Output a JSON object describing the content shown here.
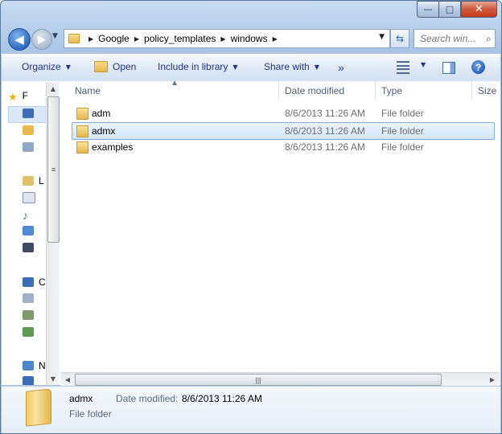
{
  "window": {
    "caption": {
      "minimize": "—",
      "maximize": "□",
      "close": "✕"
    }
  },
  "nav": {
    "back_icon": "arrow-left-icon",
    "forward_icon": "arrow-right-icon"
  },
  "address": {
    "crumbs": [
      "Google",
      "policy_templates",
      "windows"
    ]
  },
  "search": {
    "placeholder": "Search win..."
  },
  "toolbar": {
    "organize": "Organize",
    "open": "Open",
    "include": "Include in library",
    "share": "Share with",
    "more": "»"
  },
  "navpane": {
    "labels": [
      "F",
      "L",
      "C",
      "N"
    ]
  },
  "columns": {
    "name": "Name",
    "date": "Date modified",
    "type": "Type",
    "size": "Size"
  },
  "files": [
    {
      "name": "adm",
      "date": "8/6/2013 11:26 AM",
      "type": "File folder",
      "selected": false
    },
    {
      "name": "admx",
      "date": "8/6/2013 11:26 AM",
      "type": "File folder",
      "selected": true
    },
    {
      "name": "examples",
      "date": "8/6/2013 11:26 AM",
      "type": "File folder",
      "selected": false
    }
  ],
  "details": {
    "name": "admx",
    "date_label": "Date modified:",
    "date_value": "8/6/2013 11:26 AM",
    "type": "File folder"
  }
}
